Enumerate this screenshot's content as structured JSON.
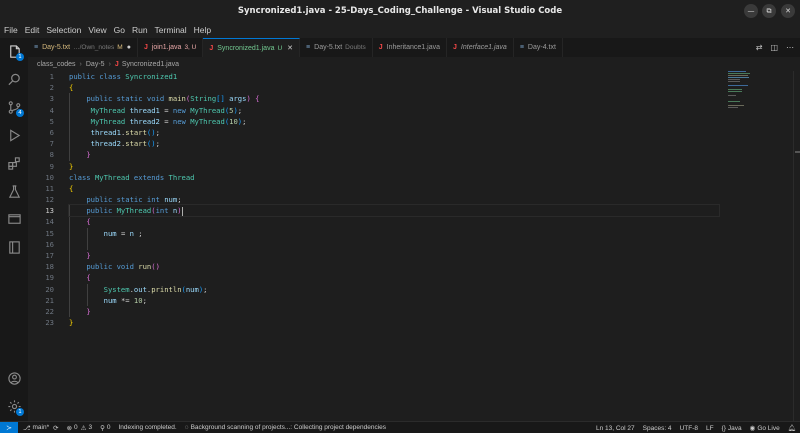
{
  "window": {
    "title": "Syncronized1.java - 25-Days_Coding_Challenge - Visual Studio Code"
  },
  "menu": [
    "File",
    "Edit",
    "Selection",
    "View",
    "Go",
    "Run",
    "Terminal",
    "Help"
  ],
  "activity_bar": {
    "explorer_badge": "1",
    "scm_badge": "4",
    "icons": [
      "files-icon",
      "search-icon",
      "source-control-icon",
      "run-debug-icon",
      "extensions-icon",
      "testing-icon",
      "remote-explorer-icon",
      "notebook-icon",
      "account-icon",
      "settings-gear-icon"
    ],
    "settings_badge": "1"
  },
  "tabs": [
    {
      "name": "Day-5.txt",
      "desc": "…/Own_notes",
      "mod": "M",
      "type": "txt",
      "state": "dot"
    },
    {
      "name": "join1.java",
      "desc": "",
      "mod": "3, U",
      "type": "java",
      "state": ""
    },
    {
      "name": "Syncronized1.java",
      "desc": "",
      "mod": "U",
      "type": "java",
      "state": "active"
    },
    {
      "name": "Day-5.txt",
      "desc": "Doubts",
      "mod": "",
      "type": "txt",
      "state": ""
    },
    {
      "name": "Inheritance1.java",
      "desc": "",
      "mod": "",
      "type": "java",
      "state": ""
    },
    {
      "name": "Interface1.java",
      "desc": "",
      "mod": "",
      "type": "java",
      "state": "italic"
    },
    {
      "name": "Day-4.txt",
      "desc": "",
      "mod": "",
      "type": "txt",
      "state": ""
    }
  ],
  "breadcrumb": [
    "class_codes",
    "Day-5",
    "Syncronized1.java"
  ],
  "editor": {
    "line_numbers": [
      "1",
      "2",
      "3",
      "4",
      "5",
      "6",
      "7",
      "8",
      "9",
      "10",
      "11",
      "12",
      "13",
      "14",
      "15",
      "16",
      "17",
      "18",
      "19",
      "20",
      "21",
      "22",
      "23"
    ],
    "current_line": 13,
    "code": [
      "public class Syncronized1",
      "{",
      "    public static void main(String[] args) {",
      "     MyThread thread1 = new MyThread(5);",
      "     MyThread thread2 = new MyThread(10);",
      "     thread1.start();",
      "     thread2.start();",
      "    }",
      "}",
      "class MyThread extends Thread",
      "{",
      "    public static int num;",
      "    public MyThread(int n)",
      "    {",
      "        num = n ;",
      "",
      "    }",
      "    public void run()",
      "    {",
      "        System.out.println(num);",
      "        num *= 10;",
      "    }",
      "}"
    ]
  },
  "status": {
    "branch": "main*",
    "errors": "0",
    "warnings": "3",
    "ports": "0",
    "indexing": "Indexing completed.",
    "background": "Background scanning of projects...: Collecting project dependencies",
    "position": "Ln 13, Col 27",
    "spaces": "Spaces: 4",
    "encoding": "UTF-8",
    "eol": "LF",
    "language": "Java",
    "golive": "Go Live"
  }
}
